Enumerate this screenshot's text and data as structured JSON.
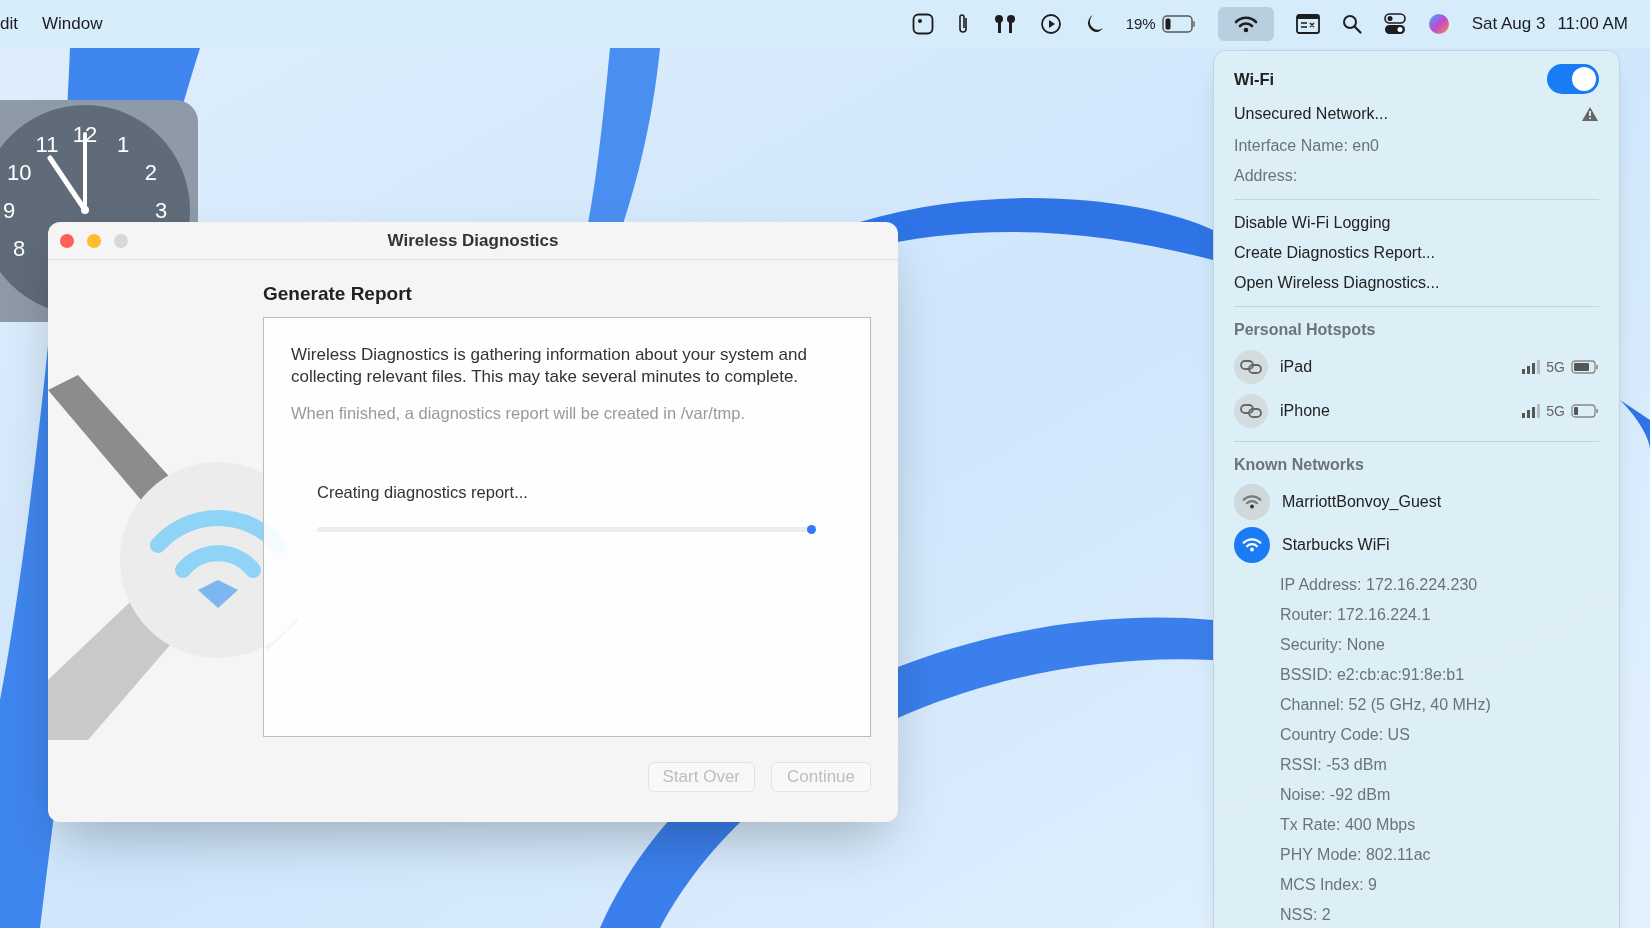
{
  "menu_bar": {
    "menus": [
      "dit",
      "Window"
    ],
    "battery_percent": "19%",
    "wifi_selected": true,
    "date": "Sat Aug 3",
    "time": "11:00 AM"
  },
  "clock_widget": {
    "numerals": [
      "12",
      "1",
      "2",
      "3",
      "11",
      "10",
      "9",
      "8"
    ]
  },
  "dialog": {
    "title": "Wireless Diagnostics",
    "heading": "Generate Report",
    "paragraph": "Wireless Diagnostics is gathering information about your system and collecting relevant files. This may take several minutes to complete.",
    "note": "When finished, a diagnostics report will be created in /var/tmp.",
    "status": "Creating diagnostics report...",
    "progress": {
      "level": 1
    },
    "buttons": [
      {
        "label": "Start Over",
        "disabled": true
      },
      {
        "label": "Continue",
        "disabled": true
      }
    ]
  },
  "wifi_menu": {
    "title": "Wi-Fi",
    "on": true,
    "warning": "Unsecured Network...",
    "info": [
      "Interface Name: en0",
      "Address:"
    ],
    "actions": [
      "Disable Wi-Fi Logging",
      "Create Diagnostics Report...",
      "Open Wireless Diagnostics..."
    ],
    "hotspots_heading": "Personal Hotspots",
    "hotspots": [
      {
        "name": "iPad",
        "band": "5G"
      },
      {
        "name": "iPhone",
        "band": "5G"
      }
    ],
    "known_heading": "Known Networks",
    "networks": [
      {
        "name": "MarriottBonvoy_Guest",
        "selected": false
      },
      {
        "name": "Starbucks WiFi",
        "selected": true
      }
    ],
    "details": [
      "IP Address: 172.16.224.230",
      "Router: 172.16.224.1",
      "Security: None",
      "BSSID: e2:cb:ac:91:8e:b1",
      "Channel: 52 (5 GHz, 40 MHz)",
      "Country Code: US",
      "RSSI: -53 dBm",
      "Noise: -92 dBm",
      "Tx Rate: 400 Mbps",
      "PHY Mode: 802.11ac",
      "MCS Index: 9",
      "NSS: 2"
    ]
  }
}
